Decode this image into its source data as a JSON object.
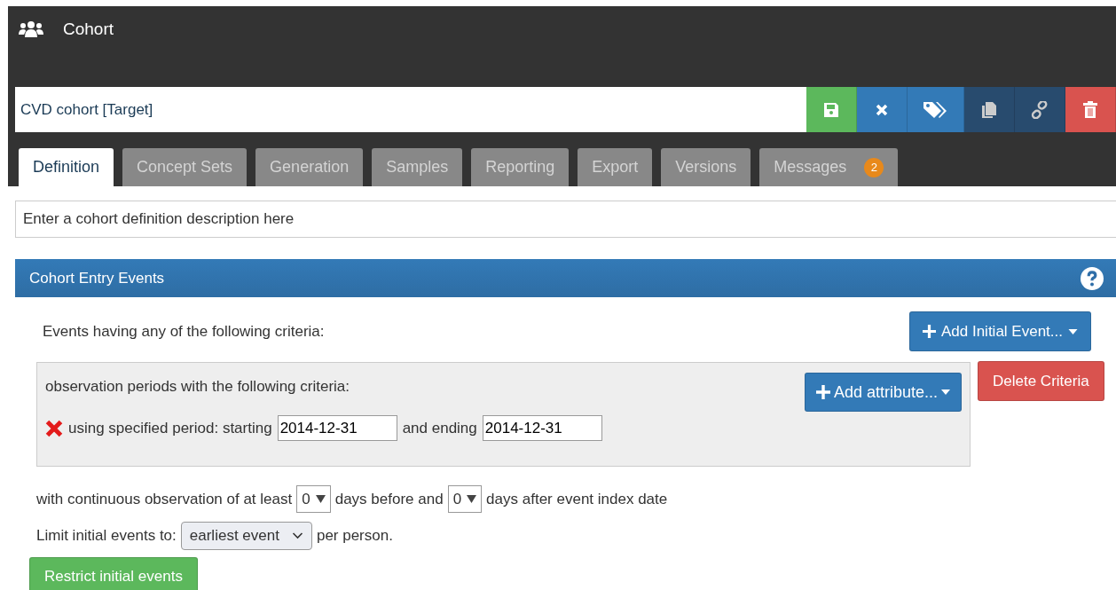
{
  "header": {
    "title": "Cohort"
  },
  "name_field": {
    "value": "CVD cohort [Target]"
  },
  "toolbar": [
    {
      "kind": "save"
    },
    {
      "kind": "close"
    },
    {
      "kind": "tags"
    },
    {
      "kind": "copy"
    },
    {
      "kind": "link"
    },
    {
      "kind": "delete"
    }
  ],
  "tabs": [
    {
      "label": "Definition",
      "selected": true
    },
    {
      "label": "Concept Sets",
      "selected": false
    },
    {
      "label": "Generation",
      "selected": false
    },
    {
      "label": "Samples",
      "selected": false
    },
    {
      "label": "Reporting",
      "selected": false
    },
    {
      "label": "Export",
      "selected": false
    },
    {
      "label": "Versions",
      "selected": false
    },
    {
      "label": "Messages",
      "selected": false,
      "badge": "2"
    }
  ],
  "description_field": {
    "placeholder": "Enter a cohort definition description here"
  },
  "panel": {
    "title": "Cohort Entry Events",
    "intro": "Events having any of the following criteria:",
    "add_initial_event": "Add Initial Event...",
    "criteria": {
      "title": "observation periods with the following criteria:",
      "add_attribute": "Add attribute...",
      "delete": "Delete Criteria",
      "period": {
        "label": "using specified period: starting",
        "start": "2014-12-31",
        "middle": "and ending",
        "end": "2014-12-31"
      }
    },
    "observation": {
      "prefix": "with continuous observation of at least",
      "before": "0",
      "middle": "days before and",
      "after": "0",
      "suffix": "days after event index date"
    },
    "limit": {
      "prefix": "Limit initial events to:",
      "value": "earliest event",
      "suffix": "per person."
    },
    "restrict": "Restrict initial events"
  }
}
